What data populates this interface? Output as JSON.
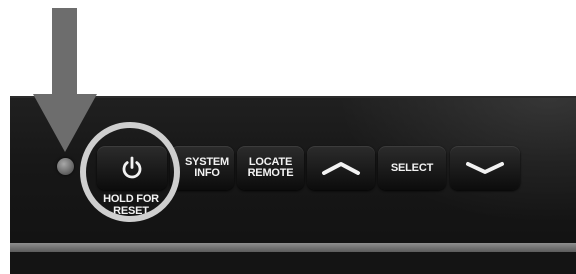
{
  "device": {
    "buttons": {
      "power_icon": "power-icon",
      "system_info_line1": "SYSTEM",
      "system_info_line2": "INFO",
      "locate_remote_line1": "LOCATE",
      "locate_remote_line2": "REMOTE",
      "up_icon": "chevron-up-icon",
      "select": "SELECT",
      "down_icon": "chevron-down-icon"
    },
    "hold_for_reset_line1": "HOLD FOR",
    "hold_for_reset_line2": "RESET",
    "led": "status-led"
  },
  "colors": {
    "panel": "#1a1a1a",
    "button": "#1f1f1f",
    "label": "#f2f2f2",
    "highlight_ring": "#cfcfcf",
    "arrow": "#6d6d6d",
    "stripe": "#7a7a7a"
  }
}
